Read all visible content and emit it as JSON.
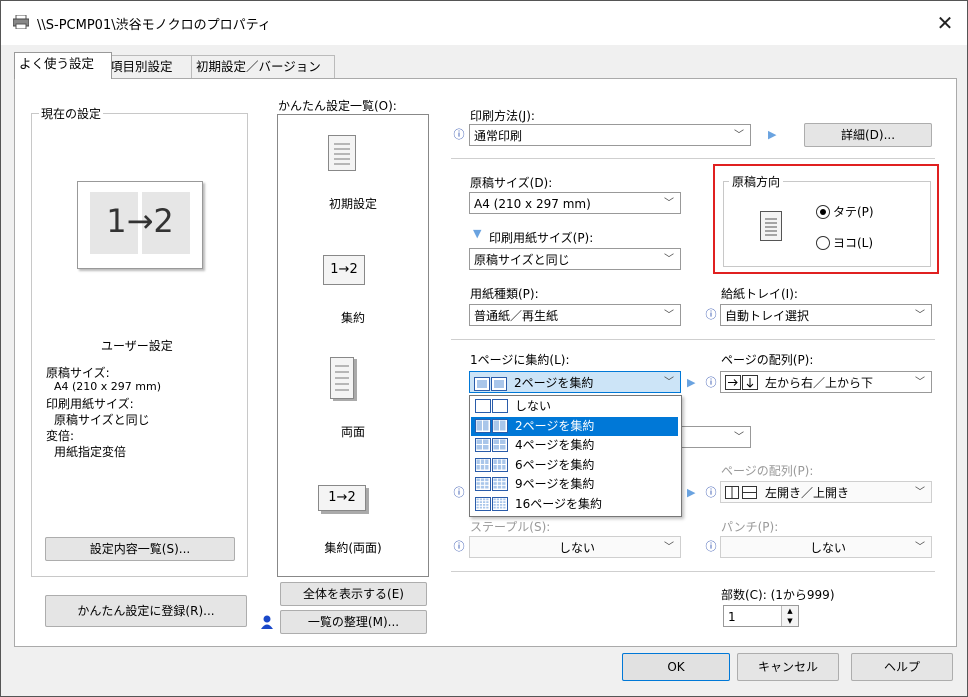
{
  "window": {
    "title": "\\\\S-PCMP01\\渋谷モノクロのプロパティ"
  },
  "tabs": [
    "よく使う設定",
    "項目別設定",
    "初期設定／バージョン"
  ],
  "left": {
    "group_title": "現在の設定",
    "preview_text": "1→2",
    "user_setting": "ユーザー設定",
    "summary": [
      "原稿サイズ:",
      "A4 (210 x 297 mm)",
      "印刷用紙サイズ:",
      "原稿サイズと同じ",
      "変倍:",
      "用紙指定変倍"
    ],
    "list_button": "設定内容一覧(S)...",
    "register_button": "かんたん設定に登録(R)..."
  },
  "presets": {
    "title": "かんたん設定一覧(O):",
    "items": [
      "初期設定",
      "集約",
      "両面",
      "集約(両面)"
    ],
    "icon_text": [
      "1→2",
      "1→2"
    ],
    "show_all_button": "全体を表示する(E)",
    "organize_button": "一覧の整理(M)..."
  },
  "settings": {
    "print_method_label": "印刷方法(J):",
    "print_method_value": "通常印刷",
    "detail_button": "詳細(D)...",
    "original_size_label": "原稿サイズ(D):",
    "original_size_value": "A4 (210 x 297 mm)",
    "paper_size_label": "印刷用紙サイズ(P):",
    "paper_size_value": "原稿サイズと同じ",
    "orientation_title": "原稿方向",
    "orientation_portrait": "タテ(P)",
    "orientation_landscape": "ヨコ(L)",
    "paper_type_label": "用紙種類(P):",
    "paper_type_value": "普通紙／再生紙",
    "tray_label": "給紙トレイ(I):",
    "tray_value": "自動トレイ選択",
    "nup_label": "1ページに集約(L):",
    "nup_value": "2ページを集約",
    "nup_options": [
      "しない",
      "2ページを集約",
      "4ページを集約",
      "6ページを集約",
      "9ページを集約",
      "16ページを集約"
    ],
    "page_order_label": "ページの配列(P):",
    "page_order_value": "左から右／上から下",
    "page_order2_label": "ページの配列(P):",
    "page_order2_value": "左開き／上開き",
    "staple_label": "ステープル(S):",
    "staple_value": "しない",
    "punch_label": "パンチ(P):",
    "punch_value": "しない",
    "copies_label": "部数(C): (1から999)",
    "copies_value": "1"
  },
  "footer": {
    "ok": "OK",
    "cancel": "キャンセル",
    "help": "ヘルプ"
  },
  "colors": {
    "highlight_border": "#e02020",
    "selection": "#0078d7",
    "info_icon": "#1a3fa6"
  }
}
